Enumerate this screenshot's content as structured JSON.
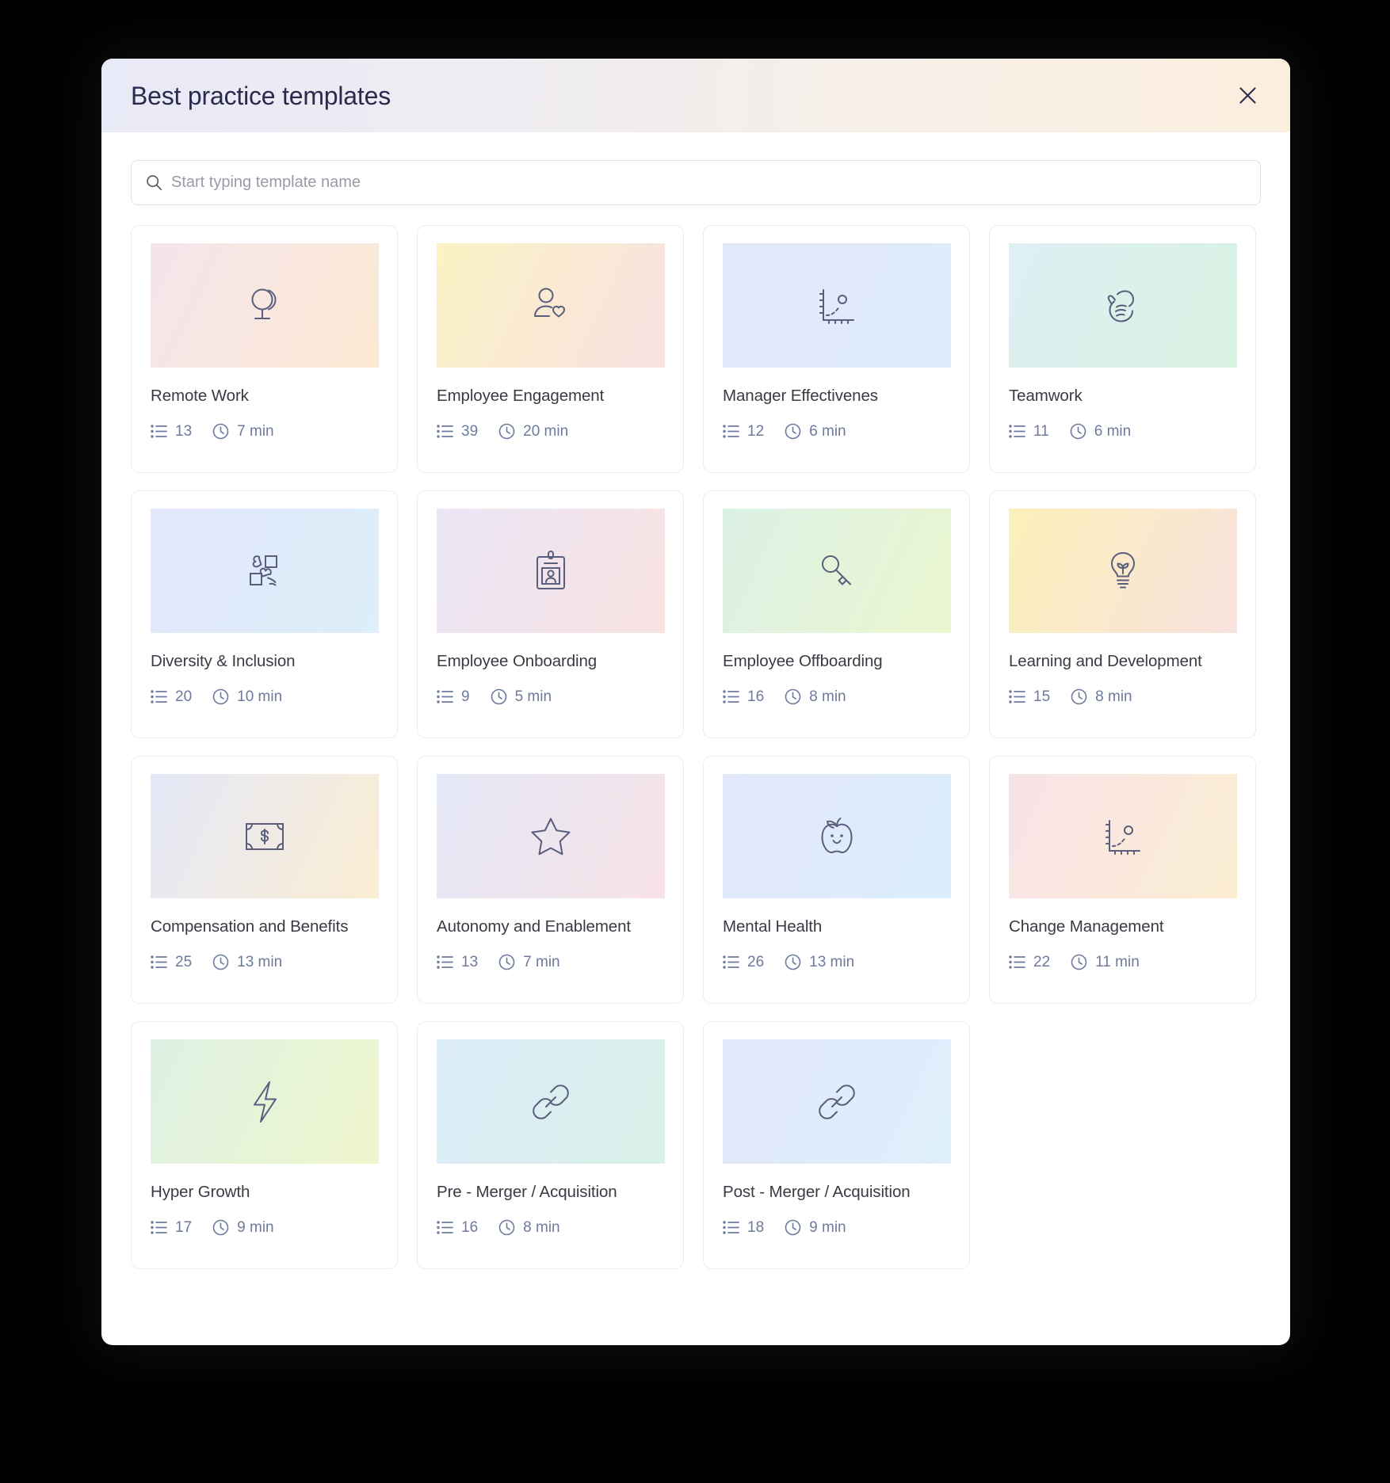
{
  "modal": {
    "title": "Best practice templates",
    "close_icon": "close-icon"
  },
  "search": {
    "placeholder": "Start typing template name",
    "value": "",
    "icon": "search-icon"
  },
  "colors": {
    "header_gradient_start": "#E9EAF7",
    "header_gradient_end": "#FAEEDD",
    "title_text": "#2B2A4C",
    "card_title_text": "#3A3A44",
    "meta_text": "#6D7A9C",
    "icon_stroke": "#5A5E7D",
    "card_border": "#ECECED",
    "search_border": "#E0E0EA",
    "backdrop": "#000000"
  },
  "templates": [
    {
      "title": "Remote Work",
      "questions": "13",
      "duration": "7 min",
      "icon": "globe-icon",
      "thumb_from": "#F6E4EC",
      "thumb_to": "#FBE9D3"
    },
    {
      "title": "Employee Engagement",
      "questions": "39",
      "duration": "20 min",
      "icon": "person-heart-icon",
      "thumb_from": "#FCF2C4",
      "thumb_to": "#F7E1E2"
    },
    {
      "title": "Manager Effectivenes",
      "questions": "12",
      "duration": "6 min",
      "icon": "growth-chart-icon",
      "thumb_from": "#E3E7FA",
      "thumb_to": "#DDEDFB"
    },
    {
      "title": "Teamwork",
      "questions": "11",
      "duration": "6 min",
      "icon": "hand-icon",
      "thumb_from": "#DDF0F4",
      "thumb_to": "#D9F2E2"
    },
    {
      "title": "Diversity & Inclusion",
      "questions": "20",
      "duration": "10 min",
      "icon": "puzzle-icon",
      "thumb_from": "#E2E7FB",
      "thumb_to": "#DCEFFA"
    },
    {
      "title": "Employee Onboarding",
      "questions": "9",
      "duration": "5 min",
      "icon": "id-badge-icon",
      "thumb_from": "#EBE6F6",
      "thumb_to": "#F9E3E2"
    },
    {
      "title": "Employee Offboarding",
      "questions": "16",
      "duration": "8 min",
      "icon": "key-icon",
      "thumb_from": "#DCF1E6",
      "thumb_to": "#EBF6CF"
    },
    {
      "title": "Learning and Development",
      "questions": "15",
      "duration": "8 min",
      "icon": "lightbulb-sprout-icon",
      "thumb_from": "#FBF0B9",
      "thumb_to": "#F8E2DE"
    },
    {
      "title": "Compensation and Benefits",
      "questions": "25",
      "duration": "13 min",
      "icon": "banknote-icon",
      "thumb_from": "#E4E8F8",
      "thumb_to": "#FBEDD2"
    },
    {
      "title": "Autonomy and Enablement",
      "questions": "13",
      "duration": "7 min",
      "icon": "star-icon",
      "thumb_from": "#E4E8F8",
      "thumb_to": "#F8E3E6"
    },
    {
      "title": "Mental Health",
      "questions": "26",
      "duration": "13 min",
      "icon": "apple-smile-icon",
      "thumb_from": "#E3E8FB",
      "thumb_to": "#DBEEFB"
    },
    {
      "title": "Change Management",
      "questions": "22",
      "duration": "11 min",
      "icon": "growth-chart-icon",
      "thumb_from": "#F8E3E8",
      "thumb_to": "#FBEDD2"
    },
    {
      "title": "Hyper Growth",
      "questions": "17",
      "duration": "9 min",
      "icon": "lightning-bolt-icon",
      "thumb_from": "#DDF1E4",
      "thumb_to": "#EFF6CC"
    },
    {
      "title": "Pre - Merger / Acquisition",
      "questions": "16",
      "duration": "8 min",
      "icon": "link-icon",
      "thumb_from": "#DCEDFA",
      "thumb_to": "#DAF1E8"
    },
    {
      "title": "Post - Merger / Acquisition",
      "questions": "18",
      "duration": "9 min",
      "icon": "link-icon",
      "thumb_from": "#E1E8FB",
      "thumb_to": "#DDEFFB"
    }
  ]
}
